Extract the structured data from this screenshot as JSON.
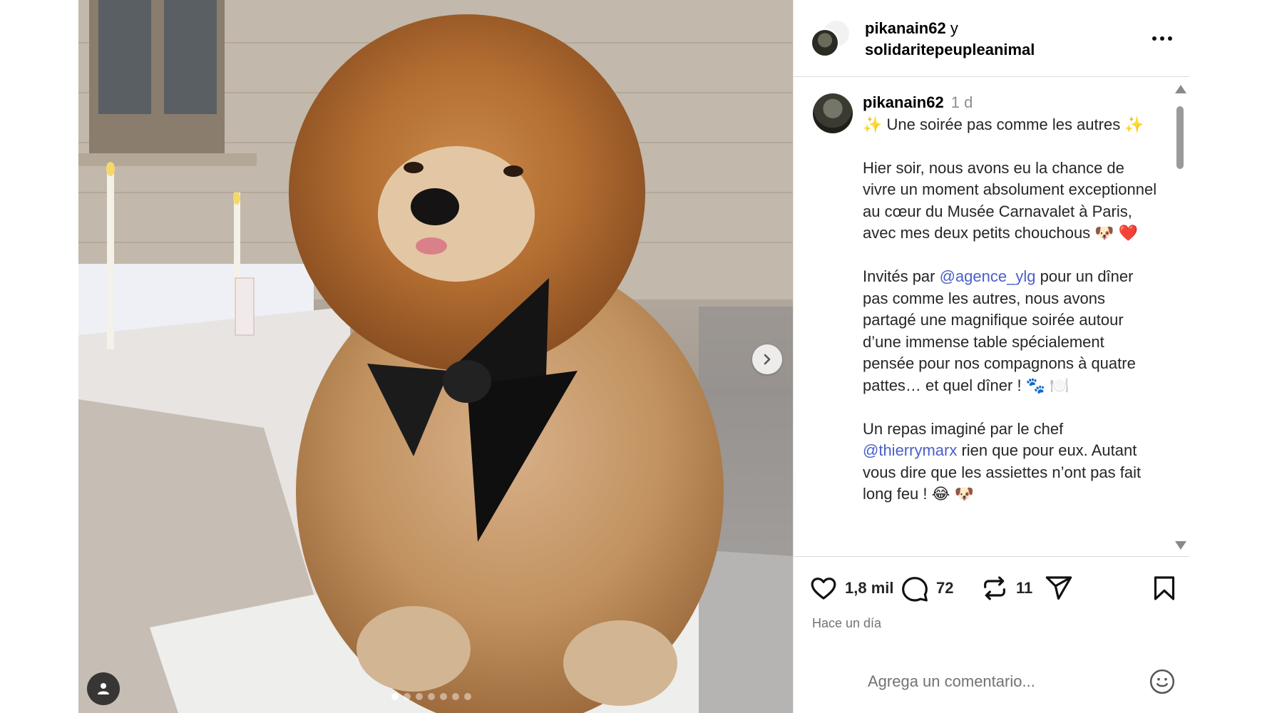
{
  "header": {
    "user1": "pikanain62",
    "joiner": " y",
    "user2": "solidaritepeupleanimal"
  },
  "caption": {
    "username": "pikanain62",
    "time": "1 d",
    "line1": "✨ Une soirée pas comme les autres ✨",
    "para1": "Hier soir, nous avons eu la chance de vivre un moment absolument exceptionnel au cœur du Musée Carnavalet à Paris, avec mes deux petits chouchous 🐶 ❤️",
    "para2_pre": "Invités par ",
    "para2_mention": "@agence_ylg",
    "para2_post": " pour un dîner pas comme les autres, nous avons partagé une magnifique soirée autour d’une immense table spécialement pensée pour nos compagnons à quatre pattes… et quel dîner ! 🐾 🍽️",
    "para3_pre": "Un repas imaginé par le chef ",
    "para3_mention": "@thierrymarx",
    "para3_post": " rien que pour eux. Autant vous dire que les assiettes n’ont pas fait long feu ! 😂 🐶"
  },
  "actions": {
    "likes": "1,8 mil",
    "comments": "72",
    "reposts": "11"
  },
  "time_ago": "Hace un día",
  "comment": {
    "placeholder": "Agrega un comentario..."
  },
  "carousel": {
    "total": 7,
    "active": 1
  },
  "icons": {
    "like": "heart-icon",
    "comment": "comment-bubble-icon",
    "repost": "repost-icon",
    "share": "send-icon",
    "save": "bookmark-icon",
    "emoji": "smiley-icon",
    "next": "chevron-right-icon",
    "tag": "user-tag-icon"
  }
}
